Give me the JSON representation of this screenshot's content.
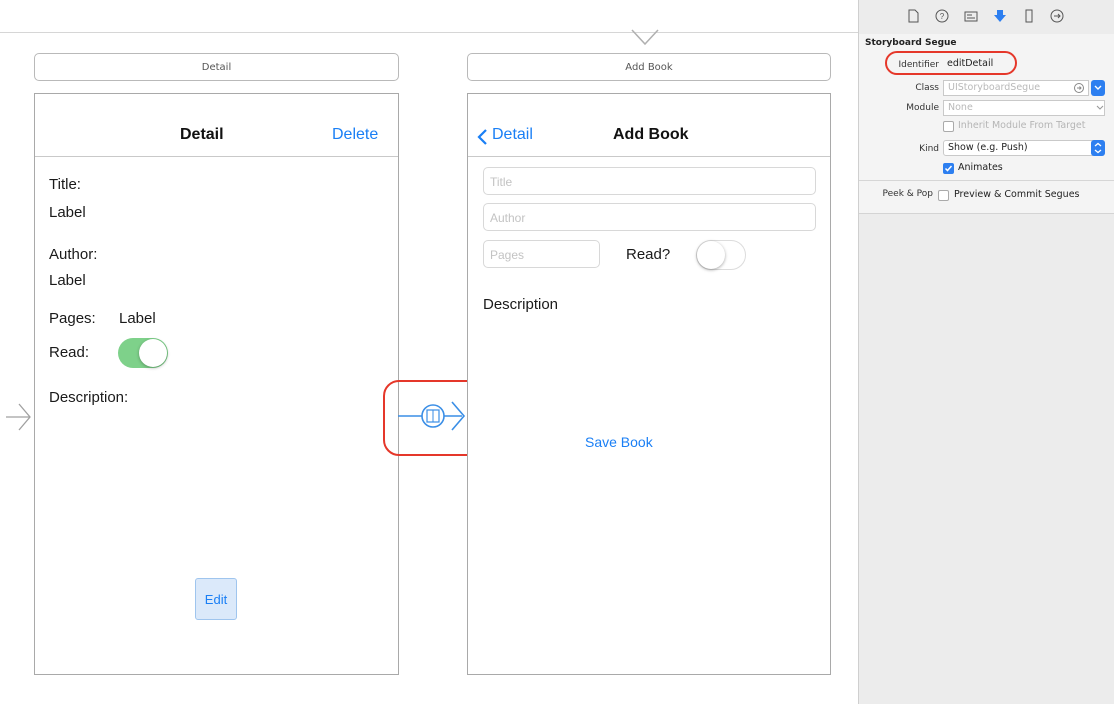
{
  "scenes": {
    "detail": {
      "title_bar": "Detail",
      "nav_title": "Detail",
      "nav_right": "Delete",
      "title_label": "Title:",
      "title_value": "Label",
      "author_label": "Author:",
      "author_value": "Label",
      "pages_label": "Pages:",
      "pages_value": "Label",
      "read_label": "Read:",
      "read_on": true,
      "description_label": "Description:",
      "edit_button": "Edit"
    },
    "add_book": {
      "title_bar": "Add Book",
      "nav_back": "Detail",
      "nav_title": "Add Book",
      "title_placeholder": "Title",
      "author_placeholder": "Author",
      "pages_placeholder": "Pages",
      "read_label": "Read?",
      "read_on": false,
      "description_label": "Description",
      "save_button": "Save Book"
    }
  },
  "inspector": {
    "tabs": [
      "file-icon",
      "help-icon",
      "identity-icon",
      "attributes-icon",
      "size-icon",
      "connections-icon"
    ],
    "selected_tab": "attributes-icon",
    "section_title": "Storyboard Segue",
    "identifier_label": "Identifier",
    "identifier_value": "editDetail",
    "class_label": "Class",
    "class_placeholder": "UIStoryboardSegue",
    "module_label": "Module",
    "module_placeholder": "None",
    "inherit_label": "Inherit Module From Target",
    "kind_label": "Kind",
    "kind_value": "Show (e.g. Push)",
    "animates_label": "Animates",
    "animates_checked": true,
    "peek_label": "Peek & Pop",
    "peek_option": "Preview & Commit Segues",
    "peek_checked": false
  },
  "colors": {
    "accent": "#1a7ff5",
    "toggle_on": "#7ed18a",
    "highlight": "#e5372a"
  }
}
